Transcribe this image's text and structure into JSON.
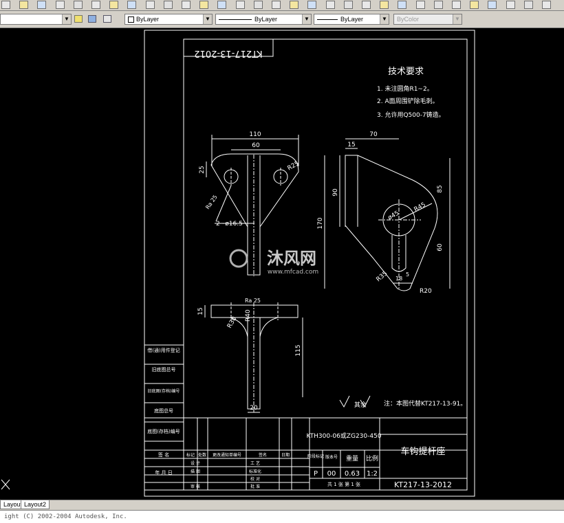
{
  "toolbar": {
    "icons": [
      "new-icon",
      "open-icon",
      "save-icon",
      "plot-icon",
      "preview-icon",
      "publish-icon",
      "cut-icon",
      "copy-icon",
      "paste-icon",
      "undo-icon",
      "redo-icon",
      "pan-icon",
      "properties-icon",
      "design-center-icon",
      "tool-palette-icon",
      "calculator-icon",
      "help-icon",
      "dim-linear-icon",
      "dim-aligned-icon",
      "dim-ordinate-icon",
      "dim-radius-icon",
      "dim-angular-icon",
      "dim-baseline-icon",
      "tolerance-icon",
      "center-mark-icon",
      "leader-icon",
      "dim-edit-icon",
      "snap-endpoint-icon",
      "snap-midpoint-icon",
      "snap-center-icon",
      "snap-node-icon"
    ]
  },
  "properties_bar": {
    "layer": "",
    "color": "ByLayer",
    "linetype": "ByLayer",
    "lineweight": "ByLayer",
    "plotstyle": "ByColor"
  },
  "drawing": {
    "rotated_code": "KT217-13-2012",
    "tech_req_title": "技术要求",
    "tech_req_items": [
      "1. 未注圆角R1~2。",
      "2. A面周围铲除毛刺。",
      "3. 允许用Q500-7铸造。"
    ],
    "dims": {
      "d110": "110",
      "d60": "60",
      "d25": "25",
      "dR25": "R25",
      "dRa": "Ra 25",
      "d2phi": "2~ø16.5",
      "d70": "70",
      "d15": "15",
      "d90": "90",
      "d170": "170",
      "d85": "85",
      "dphi45": "ø45",
      "dR45": "R45",
      "d60b": "60",
      "dR35": "R35",
      "d18": "18",
      "d5": "5",
      "dR20": "R20",
      "d15b": "15",
      "dRa2": "Ra 25",
      "dR30": "R30",
      "dR40": "R40",
      "d115": "115",
      "d20": "20"
    },
    "surface_note": "其余",
    "material_note": "注：本图代替KT217-13-91。",
    "watermark_cn": "沐风网",
    "watermark_url": "www.mfcad.com",
    "left_strip": [
      "借(通)用件登记",
      "旧底图总号",
      "旧底图(存档)编号",
      "底图总号",
      "底图(存档)编号"
    ],
    "title_block": {
      "drawing_ref": "KTH300-06或ZG230-450",
      "part_name": "车钩提杆座",
      "drawing_no": "KT217-13-2012",
      "hdr_stage": "阶段标记",
      "hdr_version": "版本号",
      "hdr_weight": "重量",
      "hdr_scale": "比例",
      "val_stage": "P",
      "val_version": "00",
      "val_weight": "0.63",
      "val_scale": "1:2",
      "sheets": "共 1 张  第 1 张",
      "sign": "签 名",
      "date": "年 月 日",
      "rev_mark": "标记",
      "rev_count": "处数",
      "rev_doc": "更改通知单编号",
      "rev_sign": "签名",
      "rev_date": "日期",
      "design": "设 计",
      "drafting": "描 图",
      "review": "审 核",
      "process": "工 艺",
      "std": "标准化",
      "check": "校 对",
      "approve": "批 准"
    }
  },
  "tabs": [
    "Layout1",
    "Layout2"
  ],
  "command_line": "ight (C) 2002-2004 Autodesk, Inc."
}
